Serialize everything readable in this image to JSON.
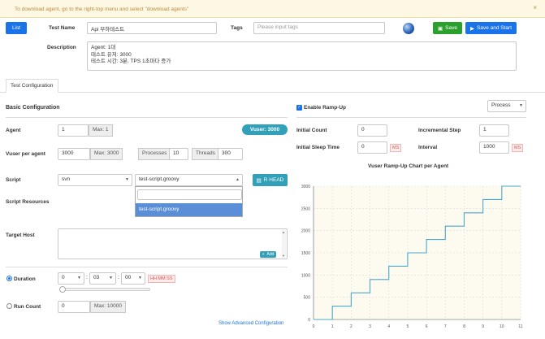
{
  "notice": {
    "text": "To download agent, go to the right-top menu and select \"download agents\"",
    "close": "×"
  },
  "header": {
    "list_label": "List",
    "test_name_label": "Test Name",
    "test_name_value": "Api 부하테스트",
    "tags_label": "Tags",
    "tags_placeholder": "Please input tags",
    "save_label": "Save",
    "save_start_label": "Save and Start",
    "description_label": "Description",
    "description_lines": [
      "Agent: 1대",
      "테스트 유저: 3000",
      "테스트 시간: 3분,    TPS 1초마다 증가"
    ]
  },
  "tab": {
    "label": "Test Configuration"
  },
  "basic": {
    "title": "Basic Configuration",
    "agent_label": "Agent",
    "agent_value": "1",
    "agent_max": "Max: 1",
    "vuser_badge": "Vuser: 3000",
    "vuser_label": "Vuser per agent",
    "vuser_value": "3000",
    "vuser_max": "Max: 3000",
    "processes_label": "Processes",
    "processes_value": "10",
    "threads_label": "Threads",
    "threads_value": "300",
    "script_label": "Script",
    "script_repo": "svn",
    "script_file": "test-script.groovy",
    "rhead_label": "R HEAD",
    "dropdown_search": "",
    "dropdown_option": "test-script.groovy",
    "resources_label": "Script Resources",
    "target_label": "Target Host",
    "add_label": "Add",
    "duration_label": "Duration",
    "duration_h": "0",
    "duration_m": "03",
    "duration_s": "00",
    "duration_fmt": "HH:MM:SS",
    "runcount_label": "Run Count",
    "runcount_value": "0",
    "runcount_max": "Max: 10000",
    "advanced_link": "Show Advanced Configuration",
    "colon": ":"
  },
  "rampup": {
    "enable_label": "Enable Ramp-Up",
    "process_select": "Process",
    "initial_count_label": "Initial Count",
    "initial_count_value": "0",
    "incremental_step_label": "Incremental Step",
    "incremental_step_value": "1",
    "initial_sleep_label": "Initial Sleep Time",
    "initial_sleep_value": "0",
    "interval_label": "Interval",
    "interval_value": "1000",
    "ms": "MS",
    "chart_title": "Vuser Ramp-Up Chart per Agent"
  },
  "chart_data": {
    "type": "line",
    "title": "Vuser Ramp-Up Chart per Agent",
    "x": [
      0,
      1,
      1,
      2,
      2,
      3,
      3,
      4,
      4,
      5,
      5,
      6,
      6,
      7,
      7,
      8,
      8,
      9,
      9,
      10,
      10,
      11
    ],
    "y": [
      0,
      0,
      300,
      300,
      600,
      600,
      900,
      900,
      1200,
      1200,
      1500,
      1500,
      1800,
      1800,
      2100,
      2100,
      2400,
      2400,
      2700,
      2700,
      3000,
      3000
    ],
    "xticks": [
      "0",
      "1",
      "2",
      "3",
      "4",
      "5",
      "6",
      "7",
      "8",
      "9",
      "10",
      "11"
    ],
    "yticks": [
      "0",
      "500",
      "1000",
      "1500",
      "2000",
      "2500",
      "3000"
    ],
    "xlim": [
      0,
      11
    ],
    "ylim": [
      0,
      3000
    ],
    "grid": true,
    "line_color": "#4aa8c8",
    "grid_color": "#ddd"
  }
}
